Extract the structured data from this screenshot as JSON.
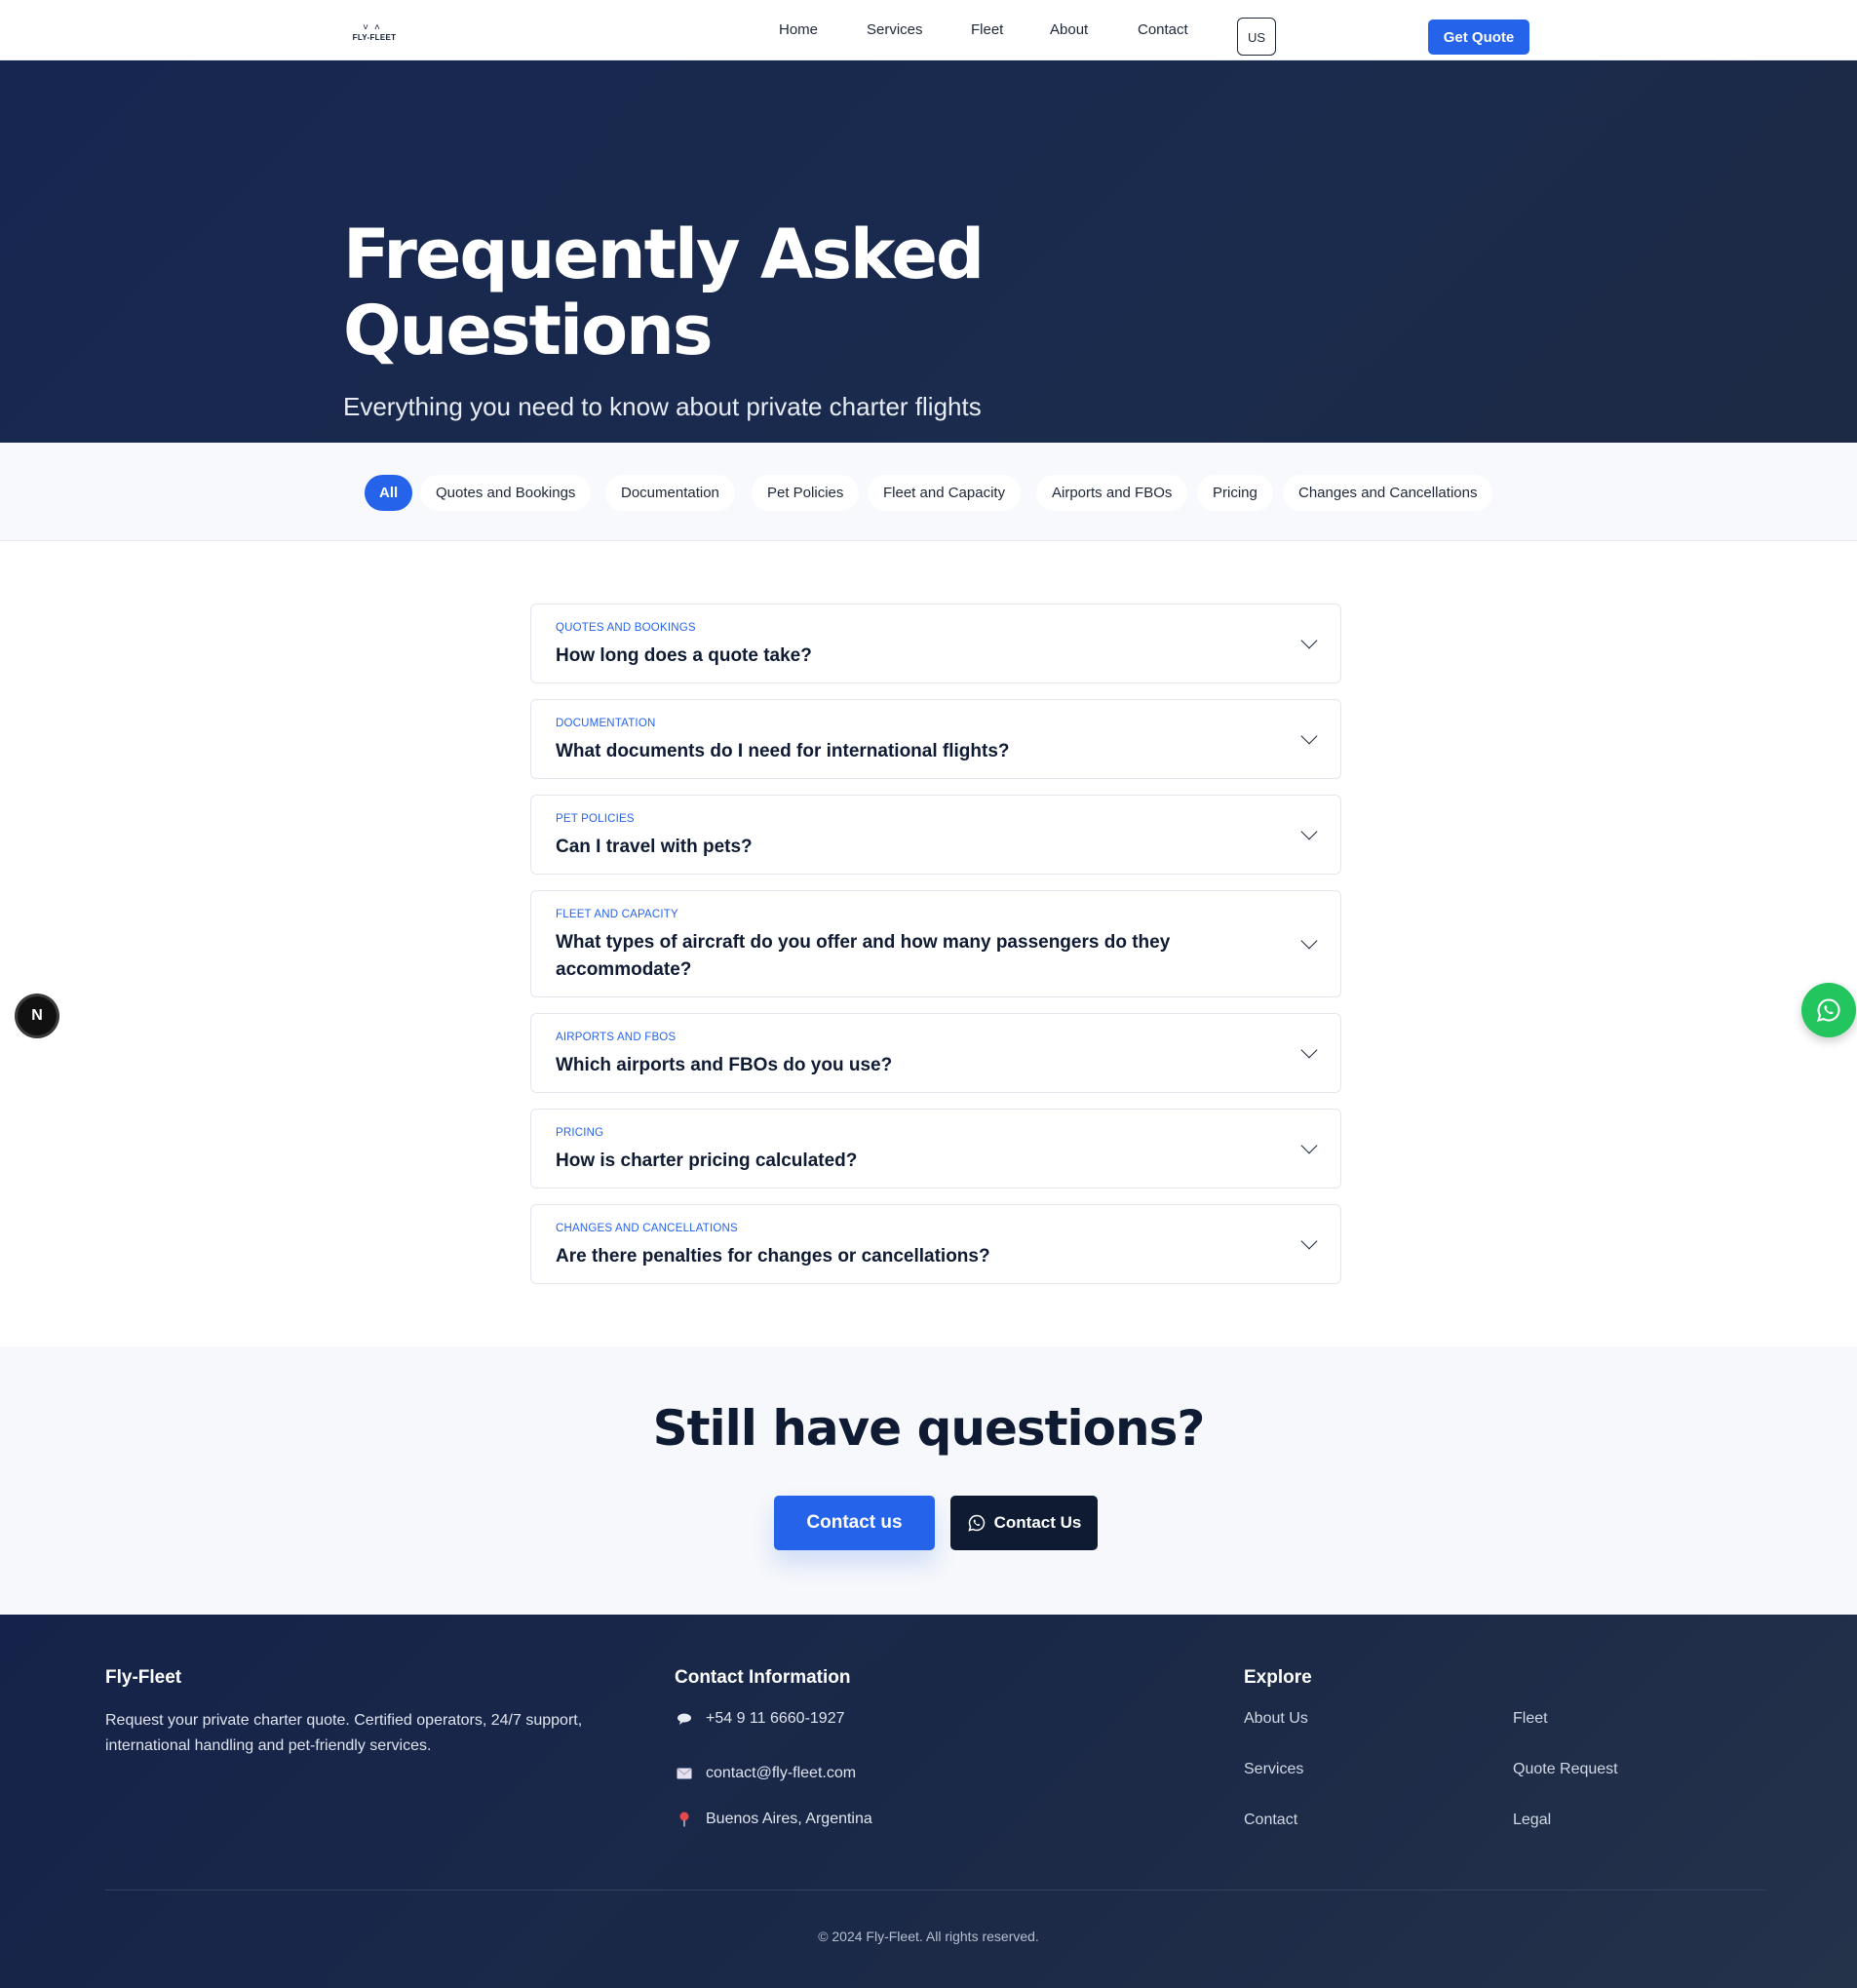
{
  "header": {
    "logo_text": "FLY-FLEET",
    "nav": [
      "Home",
      "Services",
      "Fleet",
      "About",
      "Contact"
    ],
    "lang": "US",
    "cta": "Get Quote"
  },
  "hero": {
    "title": "Frequently Asked Questions",
    "subtitle": "Everything you need to know about private charter flights"
  },
  "filters": {
    "items": [
      "All",
      "Quotes and Bookings",
      "Documentation",
      "Pet Policies",
      "Fleet and Capacity",
      "Airports and FBOs",
      "Pricing",
      "Changes and Cancellations"
    ],
    "active": "All"
  },
  "faqs": [
    {
      "category": "Quotes and Bookings",
      "question": "How long does a quote take?"
    },
    {
      "category": "Documentation",
      "question": "What documents do I need for international flights?"
    },
    {
      "category": "Pet Policies",
      "question": "Can I travel with pets?"
    },
    {
      "category": "Fleet and Capacity",
      "question": "What types of aircraft do you offer and how many passengers do they accommodate?"
    },
    {
      "category": "Airports and FBOs",
      "question": "Which airports and FBOs do you use?"
    },
    {
      "category": "Pricing",
      "question": "How is charter pricing calculated?"
    },
    {
      "category": "Changes and Cancellations",
      "question": "Are there penalties for changes or cancellations?"
    }
  ],
  "floating": {
    "left_badge": "N"
  },
  "cta": {
    "title": "Still have questions?",
    "contact_label": "Contact us",
    "whatsapp_label": "Contact Us"
  },
  "footer": {
    "brand_title": "Fly-Fleet",
    "brand_desc": "Request your private charter quote. Certified operators, 24/7 support, international handling and pet-friendly services.",
    "contact_title": "Contact Information",
    "phone": "+54 9 11 6660-1927",
    "email": "contact@fly-fleet.com",
    "address": "Buenos Aires, Argentina",
    "explore_title": "Explore",
    "explore_links": [
      "About Us",
      "Fleet",
      "Services",
      "Quote Request",
      "Contact",
      "Legal"
    ],
    "copyright": "© 2024 Fly-Fleet. All rights reserved."
  },
  "colors": {
    "accent": "#2563eb",
    "navy": "#0f1b33",
    "whatsapp": "#22c55e"
  }
}
